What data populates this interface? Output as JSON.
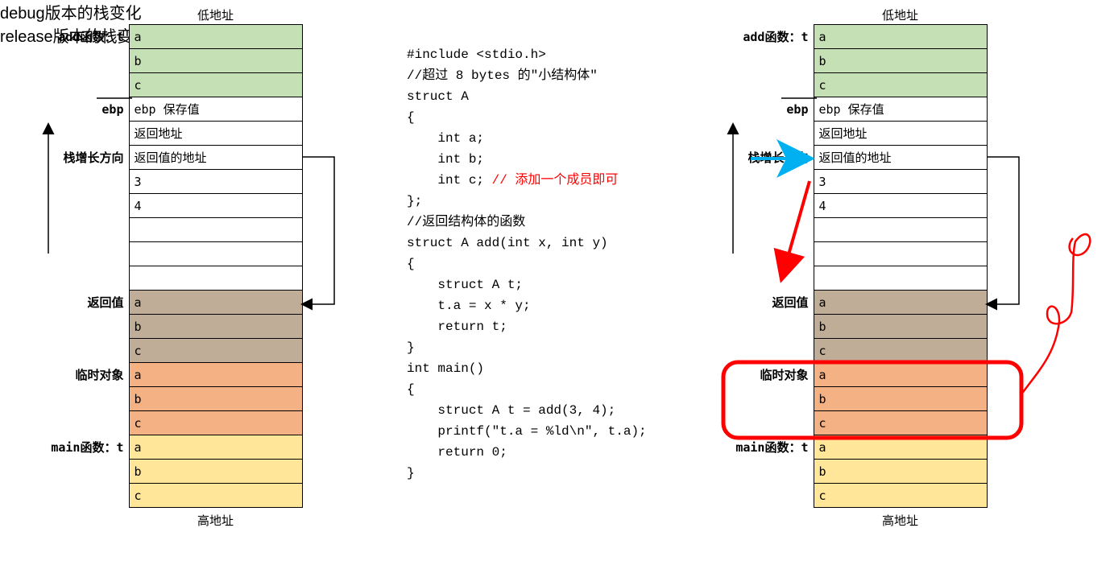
{
  "headers": {
    "low_addr": "低地址",
    "high_addr": "高地址"
  },
  "footers": {
    "debug": "debug版本的栈变化",
    "release": "release版本的栈变化"
  },
  "left_table": [
    {
      "label": "add函数：t",
      "cell": "a",
      "cls": "green"
    },
    {
      "label": "",
      "cell": "b",
      "cls": "green"
    },
    {
      "label": "",
      "cell": "c",
      "cls": "green"
    },
    {
      "label": "ebp",
      "cell": "ebp 保存值",
      "cls": ""
    },
    {
      "label": "",
      "cell": "返回地址",
      "cls": ""
    },
    {
      "label": "栈增长方向",
      "cell": "返回值的地址",
      "cls": ""
    },
    {
      "label": "",
      "cell": "3",
      "cls": ""
    },
    {
      "label": "",
      "cell": "4",
      "cls": ""
    },
    {
      "label": "",
      "cell": "",
      "cls": ""
    },
    {
      "label": "",
      "cell": "",
      "cls": ""
    },
    {
      "label": "",
      "cell": "",
      "cls": ""
    },
    {
      "label": "返回值",
      "cell": "a",
      "cls": "tan"
    },
    {
      "label": "",
      "cell": "b",
      "cls": "tan"
    },
    {
      "label": "",
      "cell": "c",
      "cls": "tan"
    },
    {
      "label": "临时对象",
      "cell": "a",
      "cls": "orange"
    },
    {
      "label": "",
      "cell": "b",
      "cls": "orange"
    },
    {
      "label": "",
      "cell": "c",
      "cls": "orange"
    },
    {
      "label": "main函数：t",
      "cell": "a",
      "cls": "yellow"
    },
    {
      "label": "",
      "cell": "b",
      "cls": "yellow"
    },
    {
      "label": "",
      "cell": "c",
      "cls": "yellow"
    }
  ],
  "right_table": [
    {
      "label": "add函数：t",
      "cell": "a",
      "cls": "green"
    },
    {
      "label": "",
      "cell": "b",
      "cls": "green"
    },
    {
      "label": "",
      "cell": "c",
      "cls": "green"
    },
    {
      "label": "ebp",
      "cell": "ebp 保存值",
      "cls": ""
    },
    {
      "label": "",
      "cell": "返回地址",
      "cls": ""
    },
    {
      "label": "栈增长方向",
      "cell": "返回值的地址",
      "cls": ""
    },
    {
      "label": "",
      "cell": "3",
      "cls": ""
    },
    {
      "label": "",
      "cell": "4",
      "cls": ""
    },
    {
      "label": "",
      "cell": "",
      "cls": ""
    },
    {
      "label": "",
      "cell": "",
      "cls": ""
    },
    {
      "label": "",
      "cell": "",
      "cls": ""
    },
    {
      "label": "返回值",
      "cell": "a",
      "cls": "tan"
    },
    {
      "label": "",
      "cell": "b",
      "cls": "tan"
    },
    {
      "label": "",
      "cell": "c",
      "cls": "tan"
    },
    {
      "label": "临时对象",
      "cell": "a",
      "cls": "orange"
    },
    {
      "label": "",
      "cell": "b",
      "cls": "orange"
    },
    {
      "label": "",
      "cell": "c",
      "cls": "orange"
    },
    {
      "label": "main函数：t",
      "cell": "a",
      "cls": "yellow"
    },
    {
      "label": "",
      "cell": "b",
      "cls": "yellow"
    },
    {
      "label": "",
      "cell": "c",
      "cls": "yellow"
    }
  ],
  "code": [
    {
      "t": "#include <stdio.h>"
    },
    {
      "t": "//超过 8 bytes 的\"小结构体\""
    },
    {
      "t": "struct A"
    },
    {
      "t": "{"
    },
    {
      "t": "    int a;"
    },
    {
      "t": "    int b;"
    },
    {
      "t": "    int c; ",
      "suffix": "// 添加一个成员即可",
      "suffix_red": true
    },
    {
      "t": "};"
    },
    {
      "t": "//返回结构体的函数"
    },
    {
      "t": "struct A add(int x, int y)"
    },
    {
      "t": "{"
    },
    {
      "t": "    struct A t;"
    },
    {
      "t": "    t.a = x * y;"
    },
    {
      "t": "    return t;"
    },
    {
      "t": "}"
    },
    {
      "t": "int main()"
    },
    {
      "t": "{"
    },
    {
      "t": "    struct A t = add(3, 4);"
    },
    {
      "t": "    printf(\"t.a = %ld\\n\", t.a);"
    },
    {
      "t": "    return 0;"
    },
    {
      "t": "}"
    }
  ]
}
